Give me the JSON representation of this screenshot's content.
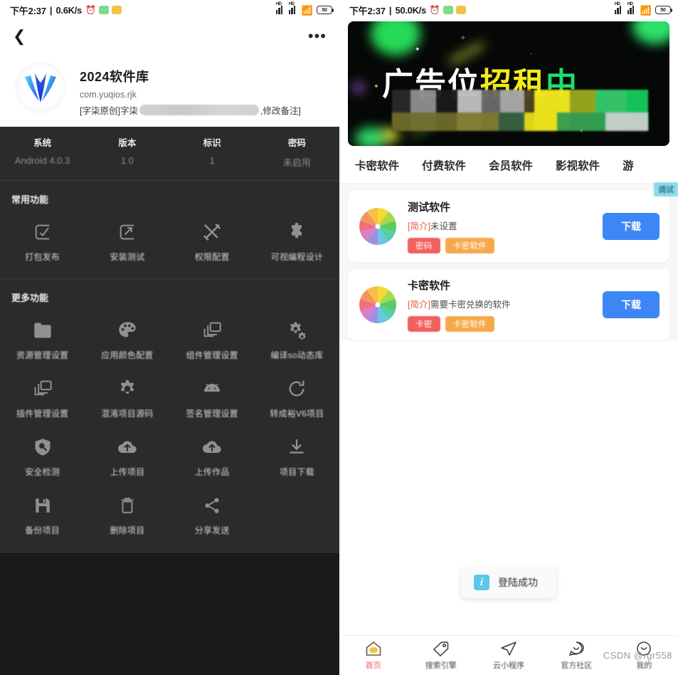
{
  "left": {
    "statusbar": {
      "time": "下午2:37",
      "separator": "|",
      "speed": "0.6K/s",
      "alarm_icon": "alarm-icon",
      "chip1": "message-chip-icon",
      "chip2": "folder-chip-icon",
      "hd_label": "HD",
      "battery_label": "50"
    },
    "nav": {
      "back_icon": "back-chevron-icon",
      "more_icon": "more-options-icon"
    },
    "app": {
      "title": "2024软件库",
      "package": "com.yuqios.rjk",
      "note_prefix": "[字柒原创]字柒",
      "note_suffix": ",修改备注]"
    },
    "info": {
      "items": [
        {
          "key": "系统",
          "value": "Android 4.0.3"
        },
        {
          "key": "版本",
          "value": "1 0"
        },
        {
          "key": "标识",
          "value": "1"
        },
        {
          "key": "密码",
          "value": "未启用"
        }
      ]
    },
    "section_common": {
      "title": "常用功能",
      "items": [
        {
          "label": "打包发布",
          "icon": "package-publish-icon"
        },
        {
          "label": "安装测试",
          "icon": "install-test-icon"
        },
        {
          "label": "权限配置",
          "icon": "permission-config-icon"
        },
        {
          "label": "可视编程设计",
          "icon": "puzzle-piece-icon"
        }
      ]
    },
    "section_more": {
      "title": "更多功能",
      "items": [
        {
          "label": "资源管理设置",
          "icon": "folder-icon"
        },
        {
          "label": "应用颜色配置",
          "icon": "palette-icon"
        },
        {
          "label": "组件管理设置",
          "icon": "layers-icon"
        },
        {
          "label": "编译so动态库",
          "icon": "gears-icon"
        },
        {
          "label": "插件管理设置",
          "icon": "layers-icon"
        },
        {
          "label": "混淆项目源码",
          "icon": "gear-icon"
        },
        {
          "label": "签名管理设置",
          "icon": "android-icon"
        },
        {
          "label": "转成裕V6项目",
          "icon": "refresh-icon"
        },
        {
          "label": "安全检测",
          "icon": "shield-search-icon"
        },
        {
          "label": "上传项目",
          "icon": "cloud-upload-icon"
        },
        {
          "label": "上传作品",
          "icon": "cloud-upload-icon"
        },
        {
          "label": "项目下载",
          "icon": "download-icon"
        },
        {
          "label": "备份项目",
          "icon": "save-icon"
        },
        {
          "label": "删除项目",
          "icon": "trash-icon"
        },
        {
          "label": "分享发送",
          "icon": "share-icon"
        }
      ]
    }
  },
  "right": {
    "statusbar": {
      "time": "下午2:37",
      "separator": "|",
      "speed": "50.0K/s",
      "alarm_icon": "alarm-icon",
      "chip1": "message-chip-icon",
      "chip2": "folder-chip-icon",
      "hd_label": "HD",
      "battery_label": "50"
    },
    "banner": {
      "text_a": "广告位",
      "text_b": "招租",
      "text_c": "中"
    },
    "tabs": [
      {
        "label": "卡密软件",
        "active": true
      },
      {
        "label": "付费软件",
        "active": false
      },
      {
        "label": "会员软件",
        "active": false
      },
      {
        "label": "影视软件",
        "active": false
      },
      {
        "label": "游",
        "active": false
      }
    ],
    "cards": [
      {
        "name": "测试软件",
        "desc_bracket": "[简介]",
        "desc_text": "未设置",
        "tags": [
          "密码",
          "卡密软件"
        ],
        "download_label": "下载",
        "badge": "调试"
      },
      {
        "name": "卡密软件",
        "desc_bracket": "[简介]",
        "desc_text": "需要卡密兑换的软件",
        "tags": [
          "卡密",
          "卡密软件"
        ],
        "download_label": "下载",
        "badge": ""
      }
    ],
    "toast": {
      "icon_letter": "i",
      "message": "登陆成功"
    },
    "bottom_nav": [
      {
        "label": "首页",
        "icon": "home-icon",
        "active": true
      },
      {
        "label": "搜索引擎",
        "icon": "tag-search-icon",
        "active": false
      },
      {
        "label": "云小程序",
        "icon": "send-plane-icon",
        "active": false
      },
      {
        "label": "官方社区",
        "icon": "smile-chat-icon",
        "active": false
      },
      {
        "label": "我的",
        "icon": "smile-profile-icon",
        "active": false
      }
    ],
    "watermark": "CSDN @rgr558"
  },
  "colors": {
    "accent_blue": "#3d86f5",
    "tag_red": "#f2605f",
    "tag_orange": "#f6a94a",
    "nav_active": "#ef5b5b",
    "dark_bg": "#2b2b2b"
  }
}
